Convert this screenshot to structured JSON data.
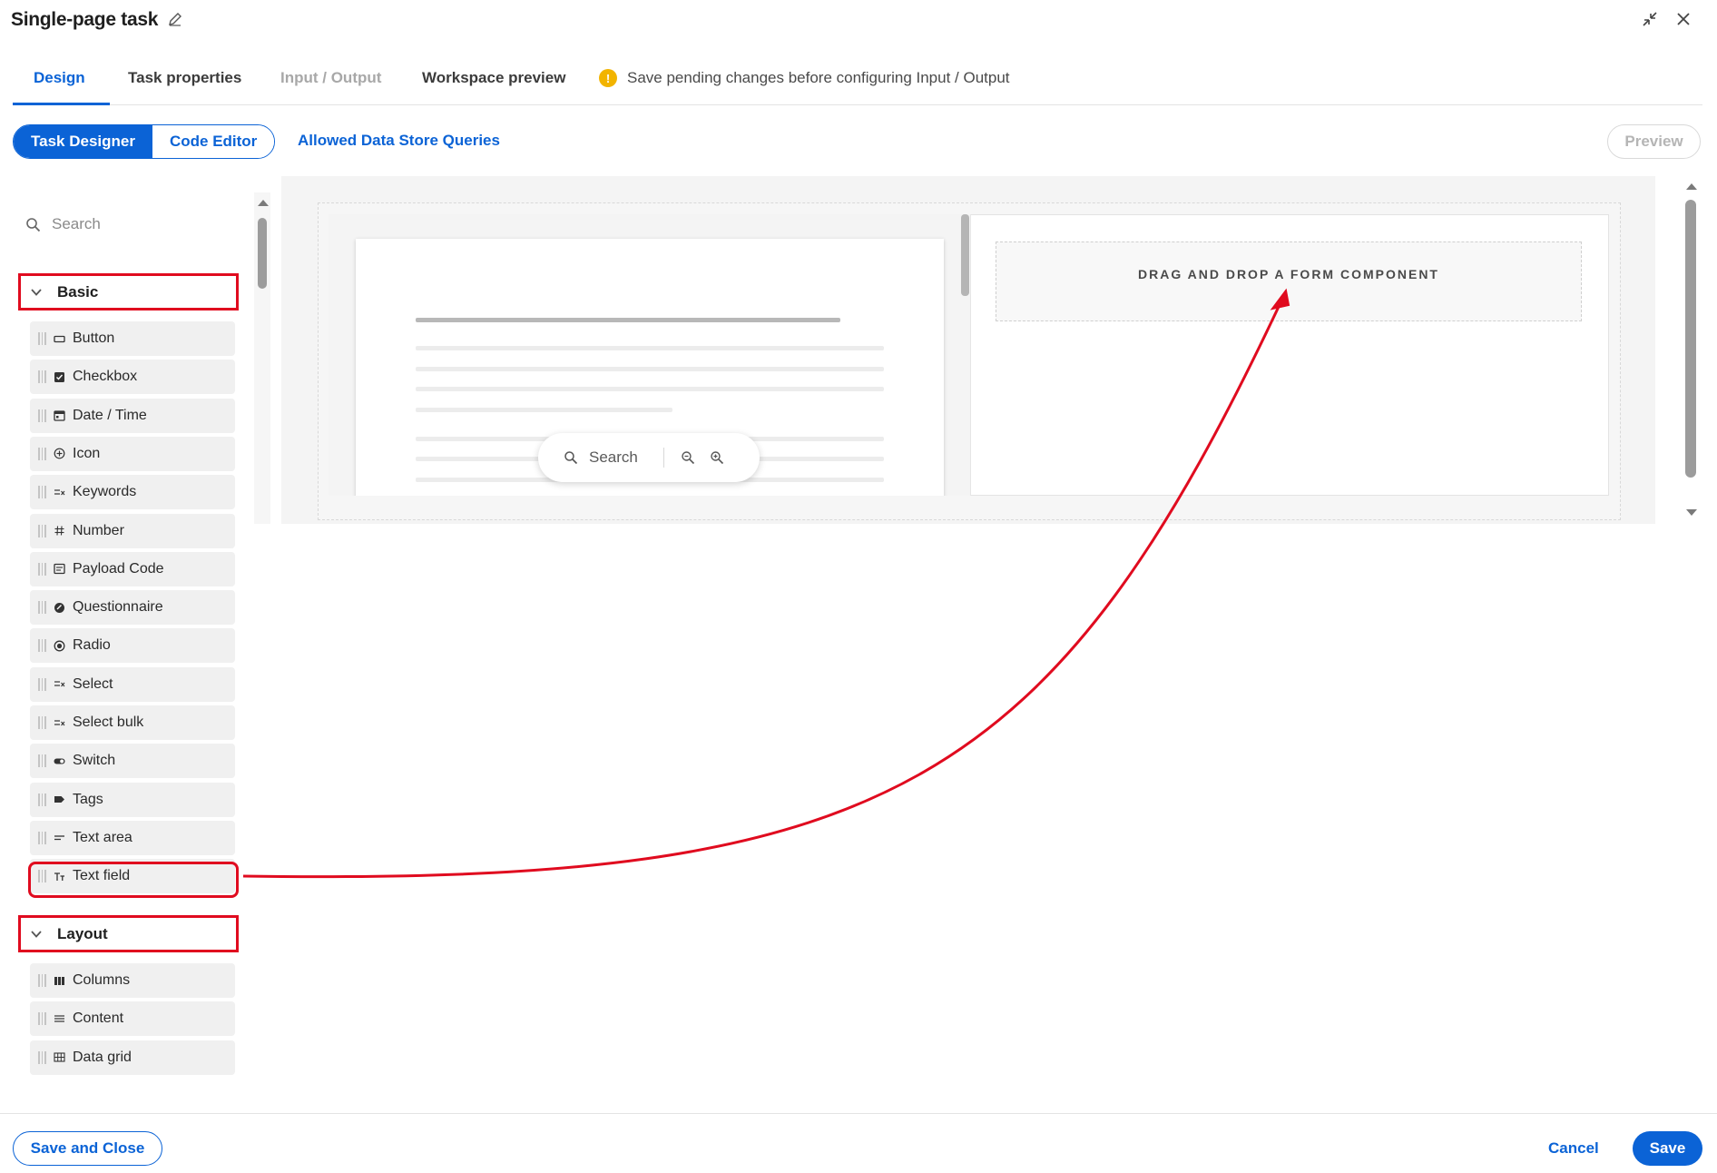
{
  "header": {
    "title": "Single-page task"
  },
  "tabs": [
    {
      "label": "Design"
    },
    {
      "label": "Task properties"
    },
    {
      "label": "Input / Output"
    },
    {
      "label": "Workspace preview"
    }
  ],
  "warning": {
    "icon": "!",
    "text": "Save pending changes before configuring Input / Output",
    "color": "#f2b400"
  },
  "toolbar": {
    "task_designer": "Task Designer",
    "code_editor": "Code Editor",
    "allowed_queries": "Allowed Data Store Queries",
    "preview": "Preview"
  },
  "sidebar": {
    "search_placeholder": "Search",
    "groups": [
      {
        "label": "Basic",
        "items": [
          {
            "label": "Button",
            "icon": "button-icon"
          },
          {
            "label": "Checkbox",
            "icon": "checkbox-icon"
          },
          {
            "label": "Date / Time",
            "icon": "calendar-icon"
          },
          {
            "label": "Icon",
            "icon": "plus-circle-icon"
          },
          {
            "label": "Keywords",
            "icon": "list-filter-icon"
          },
          {
            "label": "Number",
            "icon": "hash-icon"
          },
          {
            "label": "Payload Code",
            "icon": "code-window-icon"
          },
          {
            "label": "Questionnaire",
            "icon": "questionnaire-icon"
          },
          {
            "label": "Radio",
            "icon": "radio-icon"
          },
          {
            "label": "Select",
            "icon": "list-filter-icon"
          },
          {
            "label": "Select bulk",
            "icon": "list-filter-icon"
          },
          {
            "label": "Switch",
            "icon": "toggle-icon"
          },
          {
            "label": "Tags",
            "icon": "tag-icon"
          },
          {
            "label": "Text area",
            "icon": "text-lines-icon"
          },
          {
            "label": "Text field",
            "icon": "text-field-icon"
          }
        ]
      },
      {
        "label": "Layout",
        "items": [
          {
            "label": "Columns",
            "icon": "columns-icon"
          },
          {
            "label": "Content",
            "icon": "content-lines-icon"
          },
          {
            "label": "Data grid",
            "icon": "grid-icon"
          }
        ]
      }
    ]
  },
  "canvas": {
    "doc_search": "Search",
    "drop_zone_text": "DRAG AND DROP A FORM COMPONENT"
  },
  "footer": {
    "save_close": "Save and Close",
    "cancel": "Cancel",
    "save": "Save"
  },
  "colors": {
    "accent": "#0b63d6",
    "annotation": "#e00b1f"
  }
}
